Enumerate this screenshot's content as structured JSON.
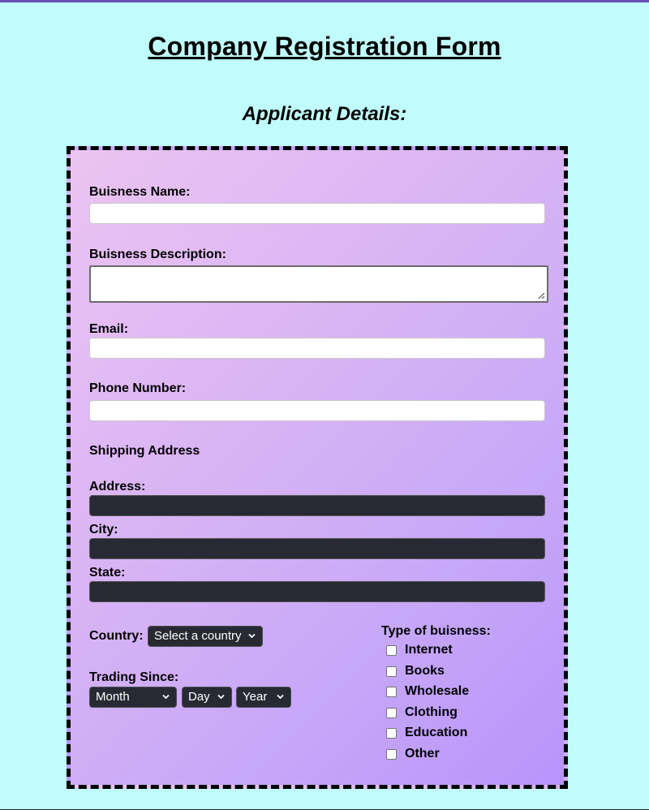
{
  "page": {
    "title": "Company Registration Form",
    "subtitle": "Applicant Details:"
  },
  "form": {
    "business_name_label": "Buisness Name:",
    "business_desc_label": "Buisness Description:",
    "email_label": "Email:",
    "phone_label": "Phone Number:",
    "shipping_heading": "Shipping Address",
    "address_label": "Address:",
    "city_label": "City:",
    "state_label": "State:",
    "country_label": "Country:",
    "country_select": "Select a country",
    "trading_since_label": "Trading Since:",
    "month_select": "Month",
    "day_select": "Day",
    "year_select": "Year",
    "business_type_label": "Type of buisness:",
    "business_types": [
      "Internet",
      "Books",
      "Wholesale",
      "Clothing",
      "Education",
      "Other"
    ]
  },
  "colors": {
    "page_background": "#c0fcfc",
    "dark_input": "#272a33",
    "top_border": "#6a4fb3"
  }
}
